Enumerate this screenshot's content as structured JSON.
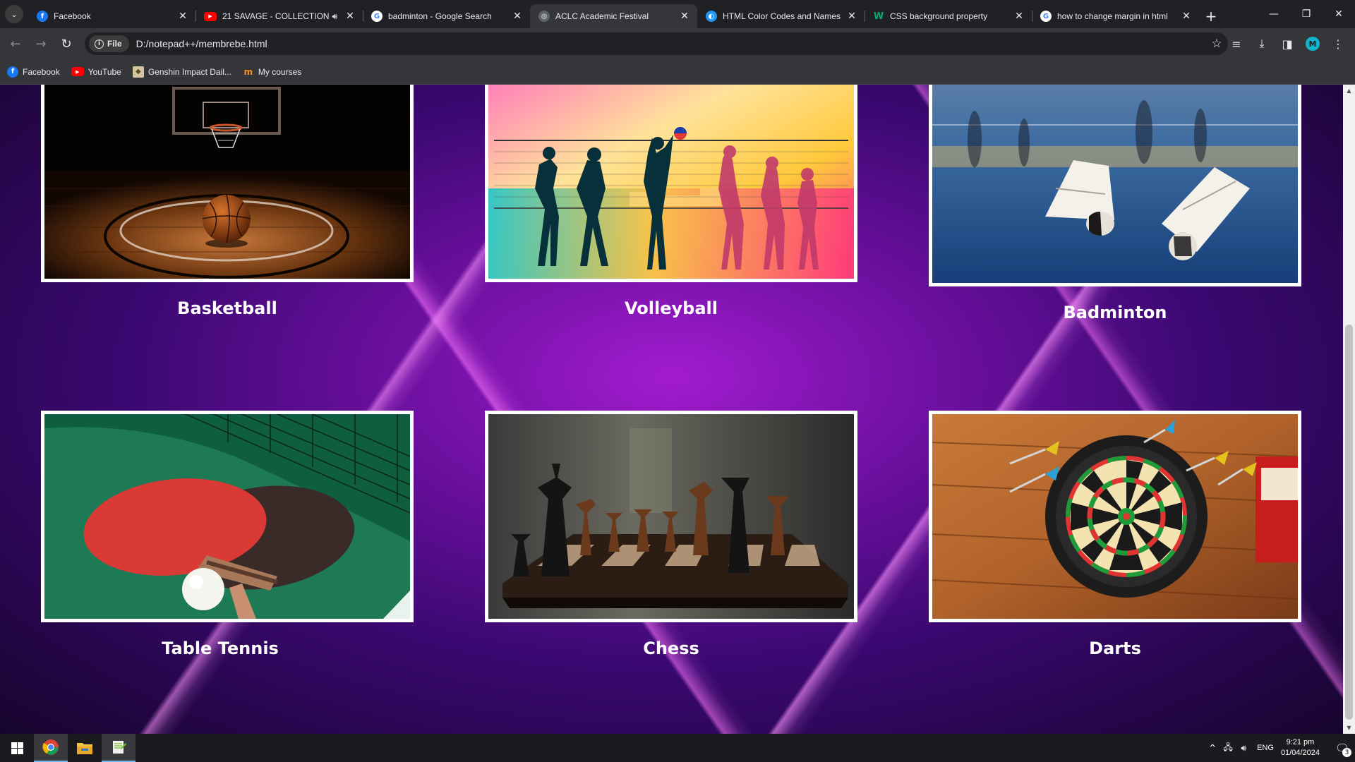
{
  "tabs": [
    {
      "title": "Facebook",
      "icon": "facebook-icon"
    },
    {
      "title": "21 SAVAGE - COLLECTION |",
      "icon": "youtube-icon",
      "audio": true
    },
    {
      "title": "badminton - Google Search",
      "icon": "google-icon"
    },
    {
      "title": "ACLC Academic Festival",
      "icon": "globe-icon",
      "active": true
    },
    {
      "title": "HTML Color Codes and Names",
      "icon": "html-colors-icon"
    },
    {
      "title": "CSS background property",
      "icon": "w3schools-icon"
    },
    {
      "title": "how to change margin in html",
      "icon": "google-icon"
    }
  ],
  "address": {
    "chip": "File",
    "url": "D:/notepad++/membrebe.html"
  },
  "profile_initial": "M",
  "bookmarks": [
    {
      "label": "Facebook",
      "icon": "facebook-icon"
    },
    {
      "label": "YouTube",
      "icon": "youtube-icon"
    },
    {
      "label": "Genshin Impact Dail...",
      "icon": "genshin-icon"
    },
    {
      "label": "My courses",
      "icon": "moodle-icon"
    }
  ],
  "sports": [
    {
      "name": "Basketball",
      "image": "basketball-court"
    },
    {
      "name": "Volleyball",
      "image": "volleyball-silhouettes"
    },
    {
      "name": "Badminton",
      "image": "shuttlecocks-court"
    },
    {
      "name": "Table Tennis",
      "image": "ping-pong-paddles"
    },
    {
      "name": "Chess",
      "image": "chess-pieces"
    },
    {
      "name": "Darts",
      "image": "dartboard"
    }
  ],
  "taskbar": {
    "language": "ENG",
    "time": "9:21 pm",
    "date": "01/04/2024",
    "notifications": "3"
  },
  "colors": {
    "page_bg": "#3a0870",
    "accent_glow": "#ff8cff",
    "frame": "#ffffff",
    "chrome_bg": "#202124",
    "toolbar_bg": "#35363a"
  }
}
